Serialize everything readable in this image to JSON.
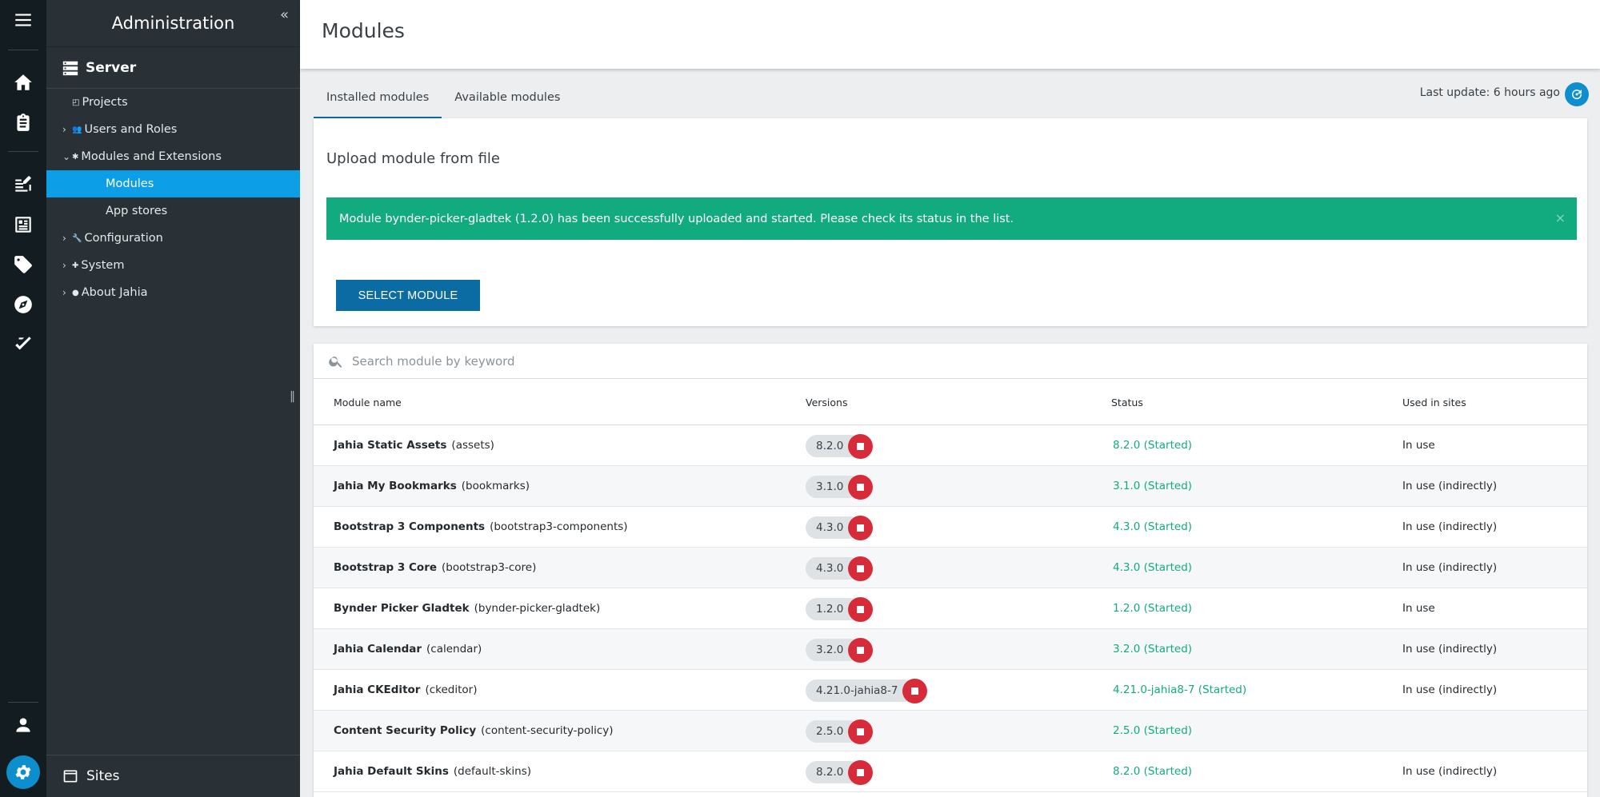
{
  "sidebar": {
    "title": "Administration",
    "collapse_icon": "double-chevron-left-icon",
    "section": "Server",
    "items": [
      {
        "label": "Projects",
        "chevron": "",
        "icon": "◰"
      },
      {
        "label": "Users and Roles",
        "chevron": "›",
        "icon": "👥"
      },
      {
        "label": "Modules and Extensions",
        "chevron": "⌄",
        "icon": "✱"
      },
      {
        "label": "Modules",
        "chevron": "",
        "icon": ""
      },
      {
        "label": "App stores",
        "chevron": "",
        "icon": ""
      },
      {
        "label": "Configuration",
        "chevron": "›",
        "icon": "🔧"
      },
      {
        "label": "System",
        "chevron": "›",
        "icon": "✚"
      },
      {
        "label": "About Jahia",
        "chevron": "›",
        "icon": "●"
      }
    ],
    "sites": "Sites"
  },
  "page": {
    "title": "Modules"
  },
  "tabs": [
    {
      "label": "Installed modules"
    },
    {
      "label": "Available modules"
    }
  ],
  "last_update": "Last update: 6 hours ago",
  "upload": {
    "title": "Upload module from file",
    "alert": "Module bynder-picker-gladtek (1.2.0) has been successfully uploaded and started. Please check its status in the list.",
    "alert_close": "×",
    "button": "SELECT MODULE"
  },
  "search": {
    "placeholder": "Search module by keyword"
  },
  "table": {
    "headers": {
      "name": "Module name",
      "versions": "Versions",
      "status": "Status",
      "used": "Used in sites"
    },
    "rows": [
      {
        "name": "Jahia Static Assets",
        "id": "(assets)",
        "version": "8.2.0",
        "status": "8.2.0 (Started)",
        "used": "In use"
      },
      {
        "name": "Jahia My Bookmarks",
        "id": "(bookmarks)",
        "version": "3.1.0",
        "status": "3.1.0 (Started)",
        "used": "In use (indirectly)"
      },
      {
        "name": "Bootstrap 3 Components",
        "id": "(bootstrap3-components)",
        "version": "4.3.0",
        "status": "4.3.0 (Started)",
        "used": "In use (indirectly)"
      },
      {
        "name": "Bootstrap 3 Core",
        "id": "(bootstrap3-core)",
        "version": "4.3.0",
        "status": "4.3.0 (Started)",
        "used": "In use (indirectly)"
      },
      {
        "name": "Bynder Picker Gladtek",
        "id": "(bynder-picker-gladtek)",
        "version": "1.2.0",
        "status": "1.2.0 (Started)",
        "used": "In use"
      },
      {
        "name": "Jahia Calendar",
        "id": "(calendar)",
        "version": "3.2.0",
        "status": "3.2.0 (Started)",
        "used": "In use (indirectly)"
      },
      {
        "name": "Jahia CKEditor",
        "id": "(ckeditor)",
        "version": "4.21.0-jahia8-7",
        "status": "4.21.0-jahia8-7 (Started)",
        "used": "In use (indirectly)"
      },
      {
        "name": "Content Security Policy",
        "id": "(content-security-policy)",
        "version": "2.5.0",
        "status": "2.5.0 (Started)",
        "used": ""
      },
      {
        "name": "Jahia Default Skins",
        "id": "(default-skins)",
        "version": "8.2.0",
        "status": "8.2.0 (Started)",
        "used": "In use (indirectly)"
      }
    ]
  },
  "colors": {
    "accent": "#0d8fce",
    "active_nav": "#0c9ee6",
    "success": "#12ab7f",
    "stop": "#d82b3a",
    "primary_button": "#0b6ca3"
  }
}
